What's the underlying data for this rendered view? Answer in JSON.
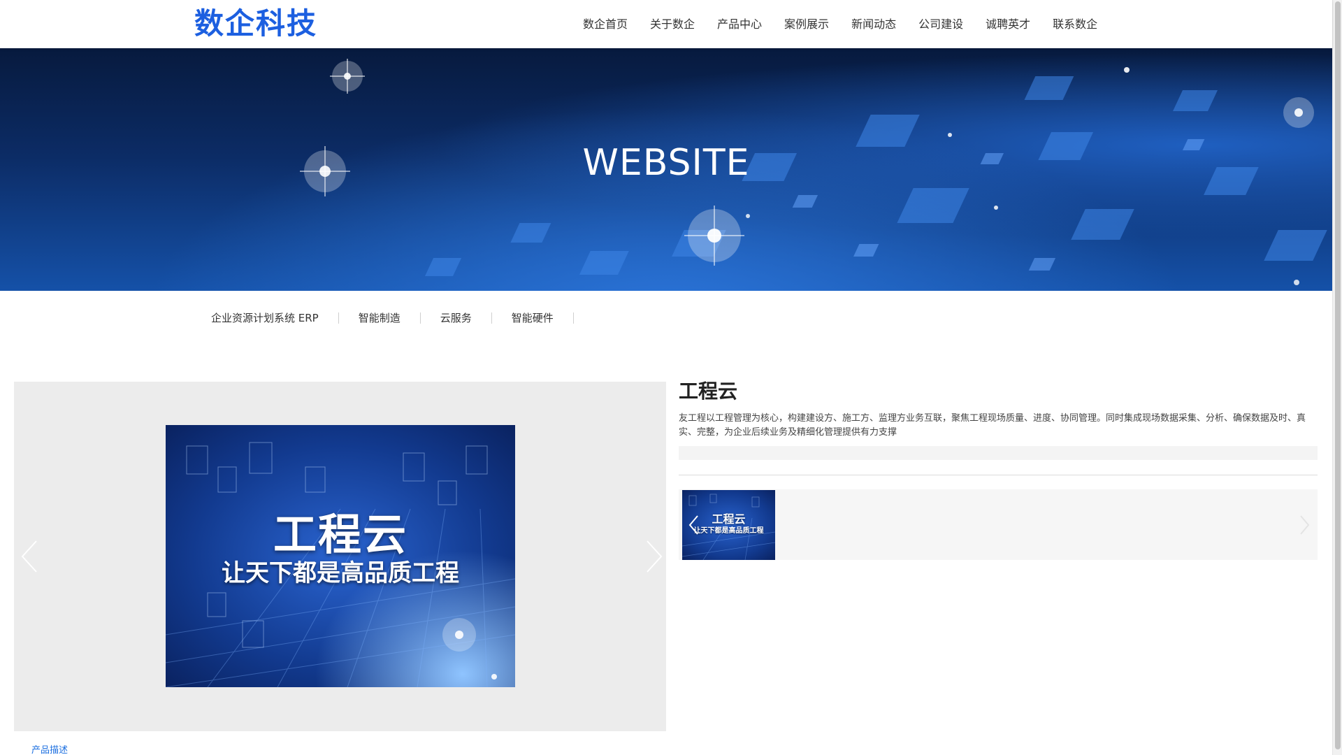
{
  "header": {
    "logo": "数企科技",
    "nav": [
      "数企首页",
      "关于数企",
      "产品中心",
      "案例展示",
      "新闻动态",
      "公司建设",
      "诚聘英才",
      "联系数企"
    ]
  },
  "banner": {
    "title": "WEBSITE"
  },
  "categories": [
    "企业资源计划系统 ERP",
    "智能制造",
    "云服务",
    "智能硬件"
  ],
  "gallery": {
    "image_title": "工程云",
    "image_subtitle": "让天下都是高品质工程",
    "prev_icon": "chevron-left-icon",
    "next_icon": "chevron-right-icon"
  },
  "product": {
    "title": "工程云",
    "description": "友工程以工程管理为核心，构建建设方、施工方、监理方业务互联，聚焦工程现场质量、进度、协同管理。同时集成现场数据采集、分析、确保数据及时、真实、完整，为企业后续业务及精细化管理提供有力支撑"
  },
  "thumbnail": {
    "title": "工程云",
    "subtitle": "让天下都是高品质工程"
  },
  "tabs": {
    "description": "产品描述"
  },
  "colors": {
    "brand": "#1c5fe0",
    "link": "#1c6fe0",
    "banner_dark": "#0c2c66",
    "gallery_bg": "#ececec"
  }
}
